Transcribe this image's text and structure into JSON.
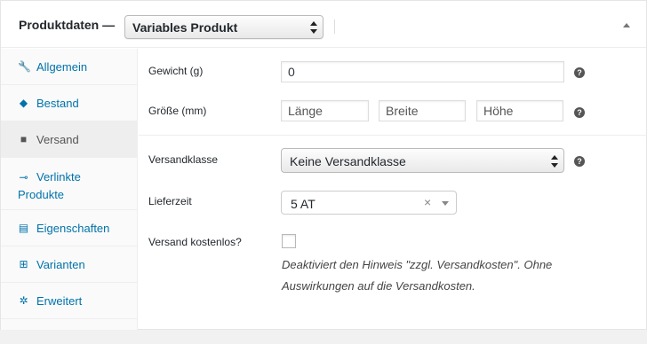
{
  "header": {
    "title": "Produktdaten —",
    "product_type": "Variables Produkt"
  },
  "sidebar": {
    "items": [
      {
        "label": "Allgemein",
        "icon": "wrench-icon",
        "glyph": "🔧"
      },
      {
        "label": "Bestand",
        "icon": "tag-icon",
        "glyph": "◆"
      },
      {
        "label": "Versand",
        "icon": "truck-icon",
        "glyph": "■",
        "active": true
      },
      {
        "label": "Verlinkte",
        "label2": "Produkte",
        "icon": "link-icon",
        "glyph": "⊸"
      },
      {
        "label": "Eigenschaften",
        "icon": "list-icon",
        "glyph": "▤"
      },
      {
        "label": "Varianten",
        "icon": "grid-icon",
        "glyph": "⊞"
      },
      {
        "label": "Erweitert",
        "icon": "gear-icon",
        "glyph": "✲"
      }
    ]
  },
  "shipping": {
    "weight_label": "Gewicht (g)",
    "weight_value": "0",
    "size_label": "Größe (mm)",
    "length_placeholder": "Länge",
    "width_placeholder": "Breite",
    "height_placeholder": "Höhe",
    "class_label": "Versandklasse",
    "class_value": "Keine Versandklasse",
    "delivery_label": "Lieferzeit",
    "delivery_value": "5 AT",
    "delivery_clear": "×",
    "free_label": "Versand kostenlos?",
    "free_checked": false,
    "free_description": "Deaktiviert den Hinweis \"zzgl. Versandkosten\". Ohne Auswirkungen auf die Versandkosten.",
    "help_glyph": "?"
  },
  "colors": {
    "link": "#0073aa",
    "active_tab_bg": "#eeeeee",
    "sidebar_bg": "#fafafa"
  }
}
